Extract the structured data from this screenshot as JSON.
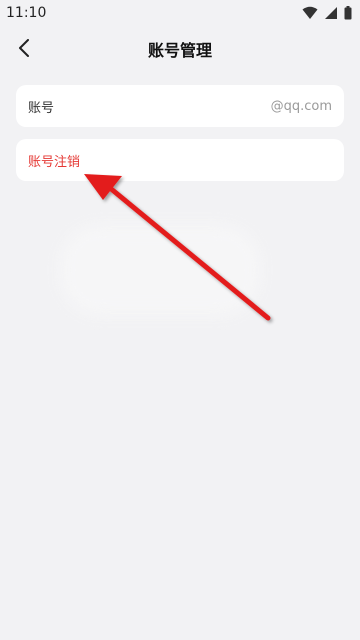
{
  "status_bar": {
    "time": "11:10"
  },
  "header": {
    "title": "账号管理"
  },
  "account_row": {
    "label": "账号",
    "value": "@qq.com"
  },
  "cancel_row": {
    "label": "账号注销"
  },
  "colors": {
    "background": "#f2f2f4",
    "card": "#ffffff",
    "danger": "#e53935",
    "arrow": "#e31e1e"
  },
  "icons": {
    "back": "chevron-left-icon",
    "wifi": "wifi-icon",
    "signal": "cellular-signal-icon",
    "battery": "battery-icon",
    "annotation": "red-arrow-icon"
  }
}
